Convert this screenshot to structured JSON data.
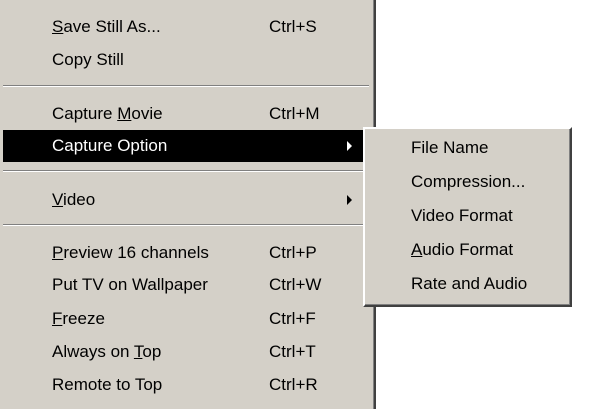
{
  "main_menu": {
    "items": [
      {
        "pre": "",
        "mn": "S",
        "post": "ave Still As...",
        "accel": "Ctrl+S"
      },
      {
        "pre": "Copy Still",
        "mn": "",
        "post": "",
        "accel": ""
      },
      {
        "pre": "Capture ",
        "mn": "M",
        "post": "ovie",
        "accel": "Ctrl+M"
      },
      {
        "pre": "Capture Option",
        "mn": "",
        "post": "",
        "accel": "",
        "submenu": true,
        "selected": true
      },
      {
        "pre": "",
        "mn": "V",
        "post": "ideo",
        "accel": "",
        "submenu": true
      },
      {
        "pre": "",
        "mn": "P",
        "post": "review 16 channels",
        "accel": "Ctrl+P"
      },
      {
        "pre": "Put TV on Wallpaper",
        "mn": "",
        "post": "",
        "accel": "Ctrl+W"
      },
      {
        "pre": "",
        "mn": "F",
        "post": "reeze",
        "accel": "Ctrl+F"
      },
      {
        "pre": "Always on ",
        "mn": "T",
        "post": "op",
        "accel": "Ctrl+T"
      },
      {
        "pre": "Remote to Top",
        "mn": "",
        "post": "",
        "accel": "Ctrl+R"
      }
    ]
  },
  "submenu": {
    "items": [
      {
        "pre": "File Name",
        "mn": "",
        "post": ""
      },
      {
        "pre": "Compression...",
        "mn": "",
        "post": ""
      },
      {
        "pre": "Video Format",
        "mn": "",
        "post": ""
      },
      {
        "pre": "",
        "mn": "A",
        "post": "udio Format"
      },
      {
        "pre": "Rate and Audio",
        "mn": "",
        "post": ""
      }
    ]
  },
  "colors": {
    "menu_face": "#d4d0c8",
    "highlight_bg": "#000000",
    "highlight_text": "#ffffff"
  }
}
